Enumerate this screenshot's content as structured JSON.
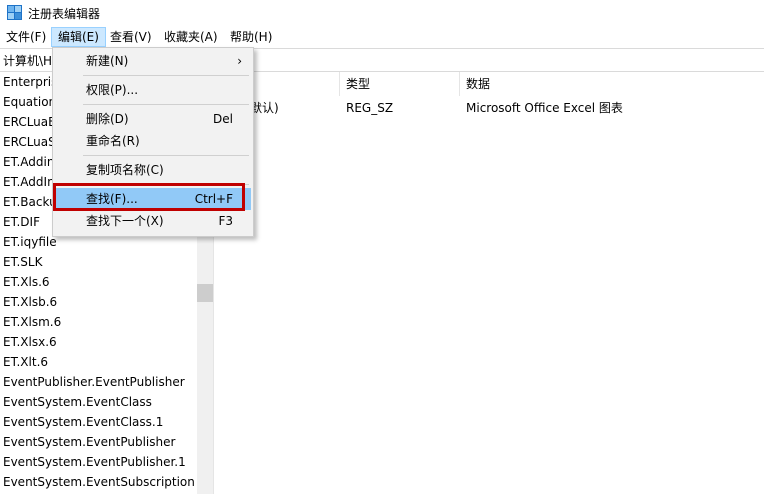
{
  "window": {
    "title": "注册表编辑器",
    "icon": "registry-editor-icon"
  },
  "menubar": [
    {
      "label": "文件(F)"
    },
    {
      "label": "编辑(E)",
      "active": true
    },
    {
      "label": "查看(V)"
    },
    {
      "label": "收藏夹(A)"
    },
    {
      "label": "帮助(H)"
    }
  ],
  "address": "计算机\\H",
  "tree": [
    "Enterpris",
    "Equation",
    "ERCLuaE",
    "ERCLuaS",
    "ET.Addin",
    "ET.AddIn",
    "ET.Backu",
    "ET.DIF",
    "ET.iqyfile",
    "ET.SLK",
    "ET.Xls.6",
    "ET.Xlsb.6",
    "ET.Xlsm.6",
    "ET.Xlsx.6",
    "ET.Xlt.6",
    "EventPublisher.EventPublisher",
    "EventSystem.EventClass",
    "EventSystem.EventClass.1",
    "EventSystem.EventPublisher",
    "EventSystem.EventPublisher.1",
    "EventSystem.EventSubscription"
  ],
  "list": {
    "headers": {
      "name": "",
      "type": "类型",
      "data": "数据"
    },
    "rows": [
      {
        "name": "默认)",
        "type": "REG_SZ",
        "data": "Microsoft Office Excel 图表"
      }
    ]
  },
  "edit_menu": {
    "items": [
      {
        "label": "新建(N)",
        "shortcut": "",
        "submenu": true
      },
      {
        "label": "权限(P)...",
        "shortcut": ""
      },
      {
        "label": "删除(D)",
        "shortcut": "Del"
      },
      {
        "label": "重命名(R)",
        "shortcut": ""
      },
      {
        "label": "复制项名称(C)",
        "shortcut": ""
      },
      {
        "label": "查找(F)...",
        "shortcut": "Ctrl+F",
        "highlighted": true
      },
      {
        "label": "查找下一个(X)",
        "shortcut": "F3"
      }
    ],
    "submenu_arrow": "›"
  },
  "colors": {
    "highlight": "#91c9f7",
    "annotation_box": "#c00000",
    "menu_active": "#cce8ff"
  }
}
